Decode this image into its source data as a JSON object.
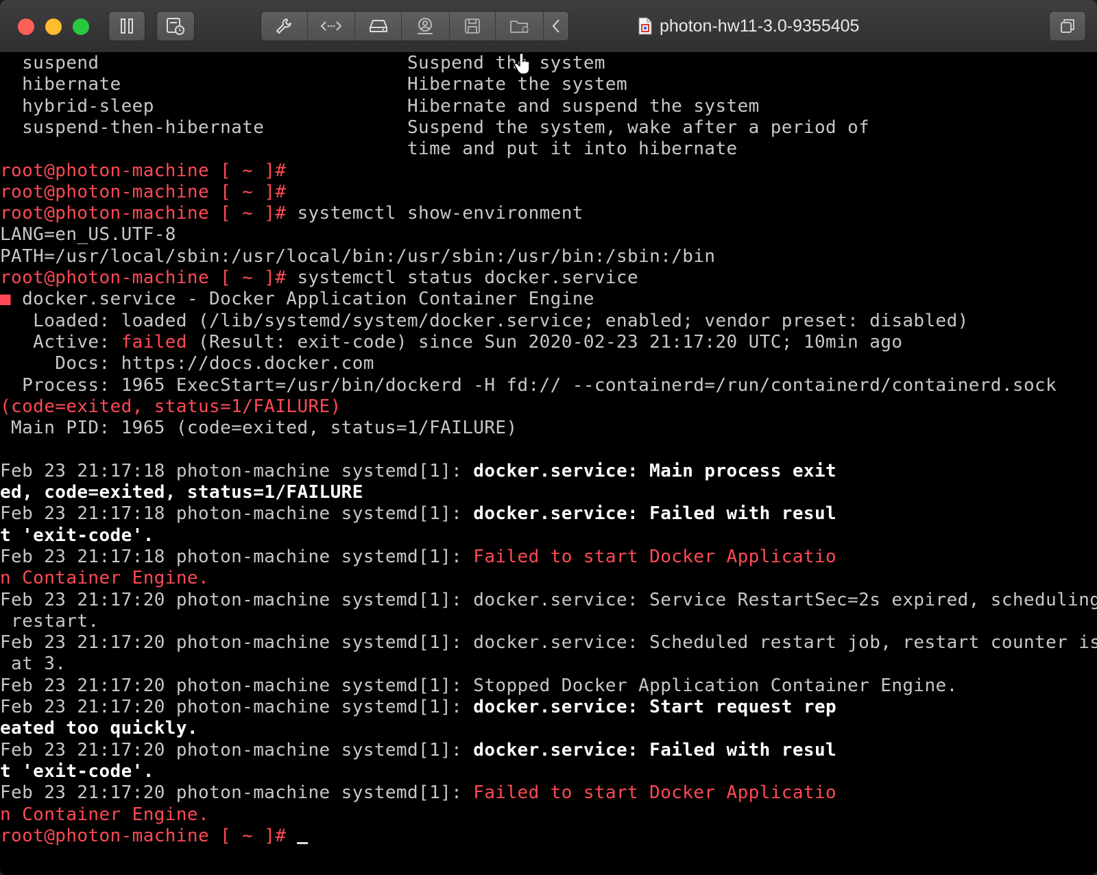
{
  "window": {
    "title": "photon-hw11-3.0-9355405",
    "toolbar_icons": [
      "pause-icon",
      "snapshot-icon",
      "wrench-icon",
      "code-arrows-icon",
      "drive-icon",
      "user-icon",
      "save-icon",
      "folder-icon",
      "chevron-left-icon",
      "window-copy-icon"
    ]
  },
  "colors": {
    "prompt_red": "#ff4a55",
    "terminal_bg": "#000000",
    "text_gray": "#c8c8c8"
  },
  "terminal": {
    "lines": [
      [
        {
          "t": "  suspend                            Suspend the system",
          "c": "gry"
        }
      ],
      [
        {
          "t": "  hibernate                          Hibernate the system",
          "c": "gry"
        }
      ],
      [
        {
          "t": "  hybrid-sleep                       Hibernate and suspend the system",
          "c": "gry"
        }
      ],
      [
        {
          "t": "  suspend-then-hibernate             Suspend the system, wake after a period of",
          "c": "gry"
        }
      ],
      [
        {
          "t": "                                     time and put it into hibernate",
          "c": "gry"
        }
      ],
      [
        {
          "t": "root@photon-machine [ ~ ]#",
          "c": "red"
        }
      ],
      [
        {
          "t": "root@photon-machine [ ~ ]#",
          "c": "red"
        }
      ],
      [
        {
          "t": "root@photon-machine [ ~ ]#",
          "c": "red"
        },
        {
          "t": " systemctl show-environment",
          "c": "gry"
        }
      ],
      [
        {
          "t": "LANG=en_US.UTF-8",
          "c": "gry"
        }
      ],
      [
        {
          "t": "PATH=/usr/local/sbin:/usr/local/bin:/usr/sbin:/usr/bin:/sbin:/bin",
          "c": "gry"
        }
      ],
      [
        {
          "t": "root@photon-machine [ ~ ]#",
          "c": "red"
        },
        {
          "t": " systemctl status docker.service",
          "c": "gry"
        }
      ],
      [
        {
          "t": "■",
          "c": "red"
        },
        {
          "t": " docker.service - Docker Application Container Engine",
          "c": "gry"
        }
      ],
      [
        {
          "t": "   Loaded: loaded (/lib/systemd/system/docker.service; enabled; vendor preset: disabled)",
          "c": "gry"
        }
      ],
      [
        {
          "t": "   Active: ",
          "c": "gry"
        },
        {
          "t": "failed",
          "c": "red"
        },
        {
          "t": " (Result: exit-code) since Sun 2020-02-23 21:17:20 UTC; 10min ago",
          "c": "gry"
        }
      ],
      [
        {
          "t": "     Docs: https://docs.docker.com",
          "c": "gry"
        }
      ],
      [
        {
          "t": "  Process: 1965 ExecStart=/usr/bin/dockerd -H fd:// --containerd=/run/containerd/containerd.sock",
          "c": "gry"
        }
      ],
      [
        {
          "t": "(code=exited, status=1/FAILURE)",
          "c": "red"
        }
      ],
      [
        {
          "t": " Main PID: 1965 (code=exited, status=1/FAILURE)",
          "c": "gry"
        }
      ],
      [
        {
          "t": "",
          "c": "gry"
        }
      ],
      [
        {
          "t": "Feb 23 21:17:18 photon-machine systemd[1]: ",
          "c": "gry"
        },
        {
          "t": "docker.service: Main process exit",
          "c": "wht"
        }
      ],
      [
        {
          "t": "ed, code=exited, status=1/FAILURE",
          "c": "wht"
        }
      ],
      [
        {
          "t": "Feb 23 21:17:18 photon-machine systemd[1]: ",
          "c": "gry"
        },
        {
          "t": "docker.service: Failed with resul",
          "c": "wht"
        }
      ],
      [
        {
          "t": "t 'exit-code'.",
          "c": "wht"
        }
      ],
      [
        {
          "t": "Feb 23 21:17:18 photon-machine systemd[1]: ",
          "c": "gry"
        },
        {
          "t": "Failed to start Docker Applicatio",
          "c": "red"
        }
      ],
      [
        {
          "t": "n Container Engine.",
          "c": "red"
        }
      ],
      [
        {
          "t": "Feb 23 21:17:20 photon-machine systemd[1]: docker.service: Service RestartSec=2s expired, scheduling",
          "c": "gry"
        }
      ],
      [
        {
          "t": " restart.",
          "c": "gry"
        }
      ],
      [
        {
          "t": "Feb 23 21:17:20 photon-machine systemd[1]: docker.service: Scheduled restart job, restart counter is",
          "c": "gry"
        }
      ],
      [
        {
          "t": " at 3.",
          "c": "gry"
        }
      ],
      [
        {
          "t": "Feb 23 21:17:20 photon-machine systemd[1]: Stopped Docker Application Container Engine.",
          "c": "gry"
        }
      ],
      [
        {
          "t": "Feb 23 21:17:20 photon-machine systemd[1]: ",
          "c": "gry"
        },
        {
          "t": "docker.service: Start request rep",
          "c": "wht"
        }
      ],
      [
        {
          "t": "eated too quickly.",
          "c": "wht"
        }
      ],
      [
        {
          "t": "Feb 23 21:17:20 photon-machine systemd[1]: ",
          "c": "gry"
        },
        {
          "t": "docker.service: Failed with resul",
          "c": "wht"
        }
      ],
      [
        {
          "t": "t 'exit-code'.",
          "c": "wht"
        }
      ],
      [
        {
          "t": "Feb 23 21:17:20 photon-machine systemd[1]: ",
          "c": "gry"
        },
        {
          "t": "Failed to start Docker Applicatio",
          "c": "red"
        }
      ],
      [
        {
          "t": "n Container Engine.",
          "c": "red"
        }
      ],
      [
        {
          "t": "root@photon-machine [ ~ ]#",
          "c": "red"
        },
        {
          "t": " ",
          "c": "gry"
        }
      ]
    ]
  }
}
